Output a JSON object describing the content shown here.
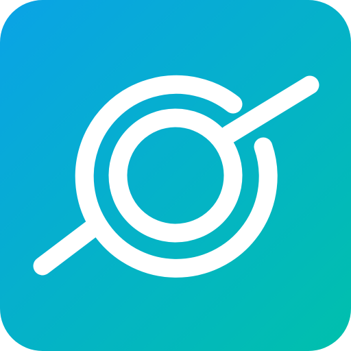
{
  "icon": {
    "name": "app-logo-icon",
    "colors": {
      "gradient_start": "#0aa3e6",
      "gradient_end": "#00c0ac",
      "foreground": "#ffffff"
    }
  }
}
